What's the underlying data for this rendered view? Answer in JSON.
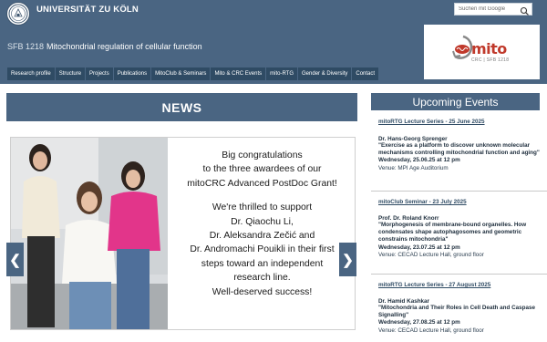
{
  "header": {
    "university": "UNIVERSITÄT ZU KÖLN",
    "search_placeholder": "Suchen mit Google",
    "sfb_number": "SFB 1218",
    "sfb_title": "Mitochondrial regulation of cellular function",
    "logo_text": "mito",
    "logo_sub": "CRC | SFB 1218"
  },
  "nav": [
    "Research profile",
    "Structure",
    "Projects",
    "Publications",
    "MitoClub & Seminars",
    "Mito & CRC Events",
    "mito-RTG",
    "Gender & Diversity",
    "Contact"
  ],
  "news": {
    "heading": "NEWS",
    "slide_lines_1": [
      "Big congratulations",
      "to the three awardees of our",
      "mitoCRC Advanced PostDoc Grant!"
    ],
    "slide_lines_2": [
      "We're thrilled to support",
      "Dr. Qiaochu Li,",
      "Dr. Aleksandra Zečić and",
      "Dr. Andromachi Pouikli in their first",
      "steps toward an independent",
      "research line.",
      "Well-deserved success!"
    ],
    "prev_label": "❮",
    "next_label": "❯"
  },
  "events": {
    "heading": "Upcoming Events",
    "items": [
      {
        "series": "mitoRTG Lecture Series - 25 June 2025",
        "speaker": "Dr. Hans-Georg Sprenger",
        "title": "\"Exercise as a platform to discover unknown molecular mechanisms controlling mitochondrial function and aging\"",
        "date": "Wednesday, 25.06.25 at 12 pm",
        "venue": "Venue: MPI Age Auditorium"
      },
      {
        "series": "mitoClub Seminar - 23 July 2025",
        "speaker": "Prof. Dr. Roland Knorr",
        "title": "\"Morphogenesis of membrane-bound organelles. How condensates shape autophagosomes and geometric constrains mitochondria\"",
        "date": "Wednesday, 23.07.25 at 12 pm",
        "venue": "Venue: CECAD Lecture Hall, ground floor"
      },
      {
        "series": "mitoRTG Lecture Series - 27 August 2025",
        "speaker": "Dr. Hamid Kashkar",
        "title": "\"Mitochondria and Their Roles in Cell Death and Caspase Signalling\"",
        "date": "Wednesday, 27.08.25 at 12 pm",
        "venue": "Venue: CECAD Lecture Hall, ground floor"
      }
    ]
  },
  "colors": {
    "brand_blue": "#4a6582",
    "nav_dark": "#2f4b64",
    "logo_red": "#c0392b"
  }
}
